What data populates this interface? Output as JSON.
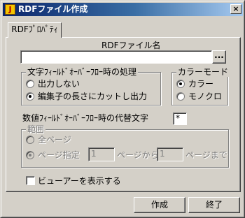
{
  "window": {
    "title": "RDFファイル作成",
    "icon_glyph": "J",
    "close_glyph": "×"
  },
  "tabs": [
    {
      "label": "RDFﾌﾟﾛﾊﾟﾃｨ",
      "selected": true
    }
  ],
  "rdf_file": {
    "label": "RDFファイル名",
    "value": "",
    "browse_label": "..."
  },
  "text_overflow": {
    "label": "文字ﾌｨｰﾙﾄﾞｵｰﾊﾞｰﾌﾛｰ時の処理",
    "options": [
      {
        "label": "出力しない",
        "checked": false
      },
      {
        "label": "編集子の長さにカットし出力",
        "checked": true
      }
    ]
  },
  "color_mode": {
    "label": "カラーモード",
    "options": [
      {
        "label": "カラー",
        "checked": true
      },
      {
        "label": "モノクロ",
        "checked": false
      }
    ]
  },
  "numeric_overflow": {
    "label": "数値ﾌｨｰﾙﾄﾞｵｰﾊﾞｰﾌﾛｰ時の代替文字",
    "value": "*"
  },
  "range": {
    "label": "範囲",
    "enabled": false,
    "options": [
      {
        "label": "全ページ",
        "checked": false
      },
      {
        "label": "ページ指定",
        "checked": true
      }
    ],
    "from_value": "1",
    "from_suffix": "ページから",
    "to_value": "1",
    "to_suffix": "ページまで"
  },
  "show_viewer": {
    "label": "ビューアーを表示する",
    "checked": false
  },
  "buttons": {
    "create_label": "作成",
    "exit_label": "終了"
  }
}
